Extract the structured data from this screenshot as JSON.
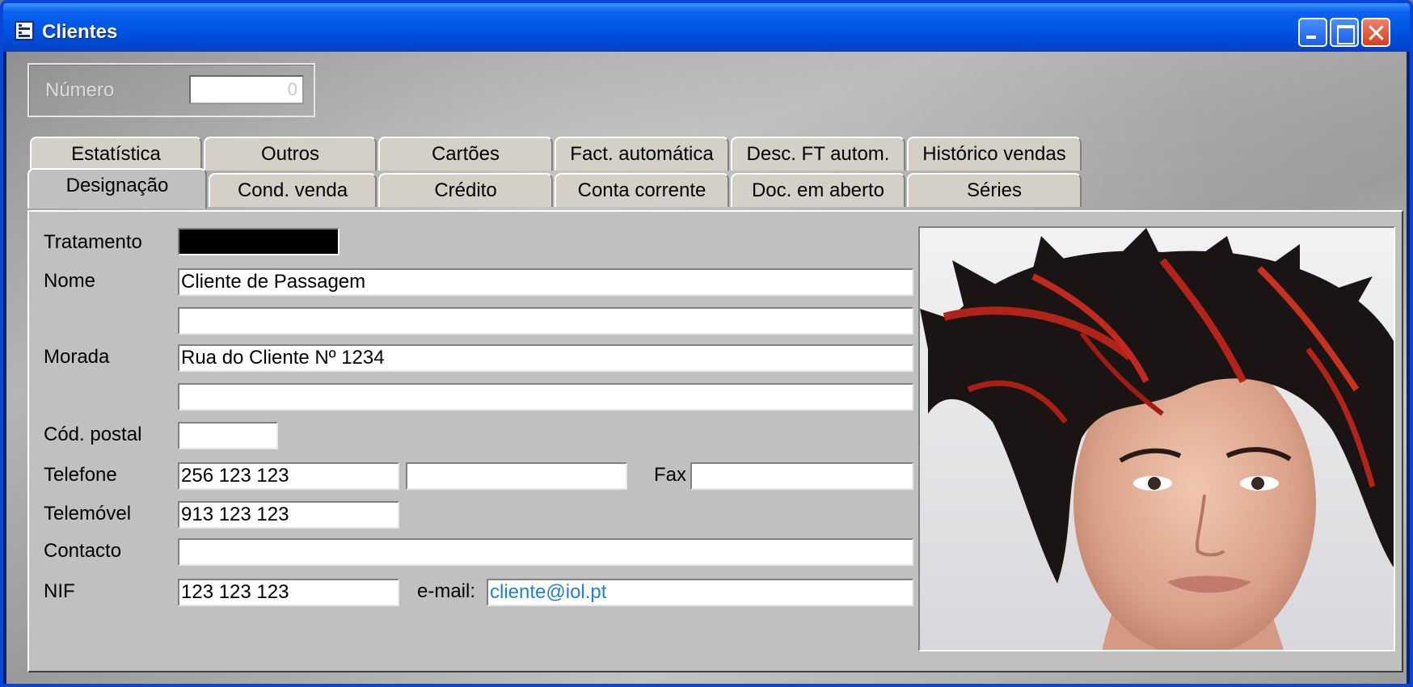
{
  "window": {
    "title": "Clientes",
    "colors": {
      "titlebar": "#0054e3",
      "close_button": "#d2401e",
      "panel": "#c0c0c0",
      "email_text": "#1f7fd6"
    }
  },
  "header": {
    "numero_label": "Número",
    "numero_value": "0"
  },
  "tabs_row1": [
    "Estatística",
    "Outros",
    "Cartões",
    "Fact. automática",
    "Desc. FT autom.",
    "Histórico vendas"
  ],
  "tabs_row2": [
    "Designação",
    "Cond. venda",
    "Crédito",
    "Conta corrente",
    "Doc. em aberto",
    "Séries"
  ],
  "active_tab": "Designação",
  "form": {
    "tratamento_label": "Tratamento",
    "tratamento_value": "",
    "nome_label": "Nome",
    "nome_value": "Cliente de Passagem",
    "nome2_value": "",
    "morada_label": "Morada",
    "morada_value": "Rua do Cliente Nº 1234",
    "morada2_value": "",
    "cod_postal_label": "Cód. postal",
    "cod_postal_value": "",
    "telefone_label": "Telefone",
    "telefone_value": "256 123 123",
    "telefone2_value": "",
    "fax_label": "Fax",
    "fax_value": "",
    "telemovel_label": "Telemóvel",
    "telemovel_value": "913 123 123",
    "contacto_label": "Contacto",
    "contacto_value": "",
    "nif_label": "NIF",
    "nif_value": "123 123 123",
    "email_label": "e-mail:",
    "email_value": "cliente@iol.pt"
  },
  "photo": {
    "icon": "client-photo"
  }
}
